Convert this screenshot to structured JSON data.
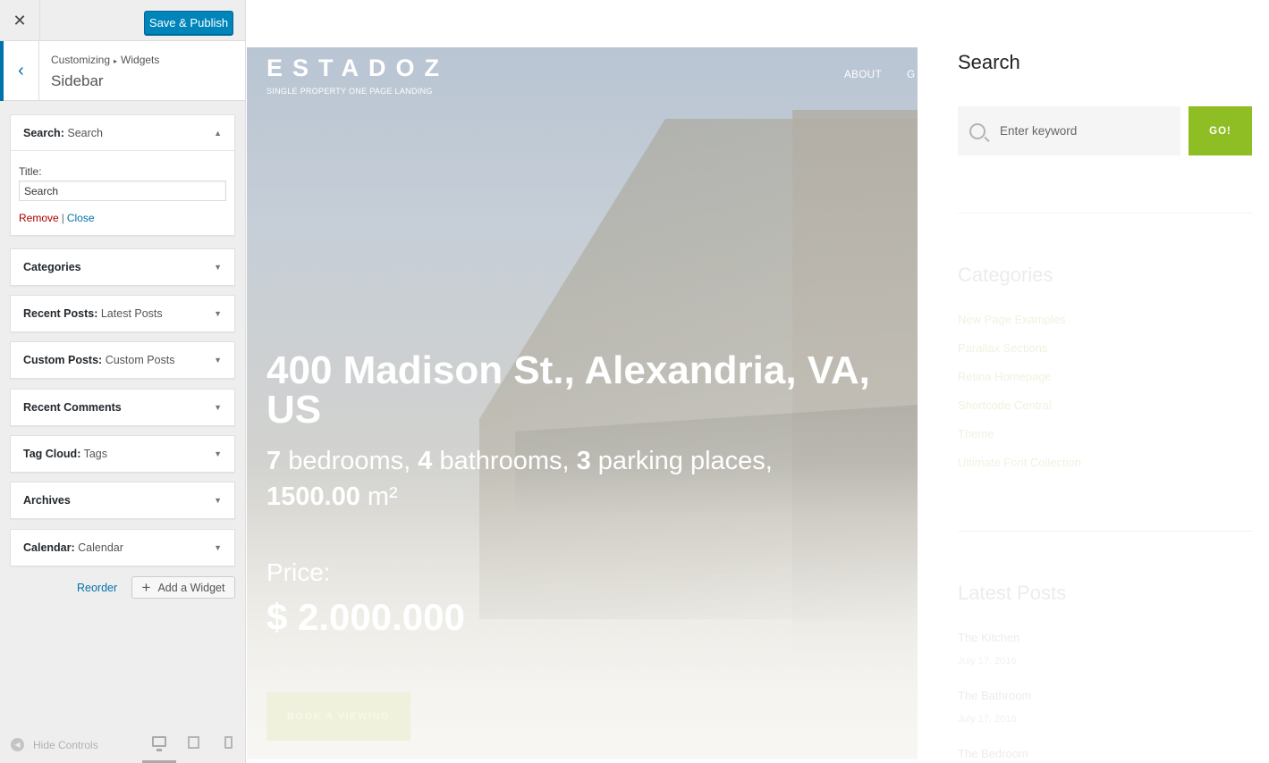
{
  "customizer": {
    "close_symbol": "✕",
    "publish_label": "Save & Publish",
    "back_symbol": "‹",
    "breadcrumb": {
      "root": "Customizing",
      "separator": "▸",
      "current": "Widgets"
    },
    "section_title": "Sidebar",
    "widgets": [
      {
        "name": "Search",
        "subtitle": "Search",
        "open": true,
        "caret": "▲"
      },
      {
        "name": "Categories",
        "subtitle": "",
        "caret": "▼"
      },
      {
        "name": "Recent Posts",
        "subtitle": "Latest Posts",
        "caret": "▼"
      },
      {
        "name": "Custom Posts",
        "subtitle": "Custom Posts",
        "caret": "▼"
      },
      {
        "name": "Recent Comments",
        "subtitle": "",
        "caret": "▼"
      },
      {
        "name": "Tag Cloud",
        "subtitle": "Tags",
        "caret": "▼"
      },
      {
        "name": "Archives",
        "subtitle": "",
        "caret": "▼"
      },
      {
        "name": "Calendar",
        "subtitle": "Calendar",
        "caret": "▼"
      }
    ],
    "search_widget": {
      "title_label": "Title:",
      "title_value": "Search",
      "remove_label": "Remove",
      "separator": "|",
      "close_label": "Close"
    },
    "reorder_label": "Reorder",
    "add_widget_plus": "+",
    "add_widget_label": "Add a Widget",
    "hide_controls_label": "Hide Controls",
    "hide_controls_icon": "◀"
  },
  "preview": {
    "logo": "ESTADOZ",
    "tagline": "SINGLE PROPERTY ONE PAGE LANDING",
    "nav": [
      "ABOUT",
      "G"
    ],
    "address": "400 Madison St., Alexandria, VA, US",
    "specs": {
      "bedrooms_num": "7",
      "bedrooms_label": " bedrooms, ",
      "bathrooms_num": "4",
      "bathrooms_label": " bathrooms, ",
      "parking_num": "3",
      "parking_label": " parking places,",
      "area_num": "1500.00",
      "area_unit": " m²"
    },
    "price_label": "Price:",
    "price_value": "$ 2.000.000",
    "cta_label": "BOOK A VIEWING",
    "sidebar": {
      "search_heading": "Search",
      "search_placeholder": "Enter keyword",
      "go_label": "GO!",
      "categories_heading": "Categories",
      "categories": [
        "New Page Examples",
        "Parallax Sections",
        "Retina Homepage",
        "Shortcode Central",
        "Theme",
        "Ultimate Font Collection"
      ],
      "latest_heading": "Latest Posts",
      "posts": [
        {
          "title": "The Kitchen",
          "date": "July 17, 2016"
        },
        {
          "title": "The Bathroom",
          "date": "July 17, 2016"
        },
        {
          "title": "The Bedroom"
        }
      ]
    }
  },
  "colors": {
    "publish_blue": "#0085ba",
    "link_blue": "#0073aa",
    "remove_red": "#aa0000",
    "go_green": "#8fbd24"
  }
}
